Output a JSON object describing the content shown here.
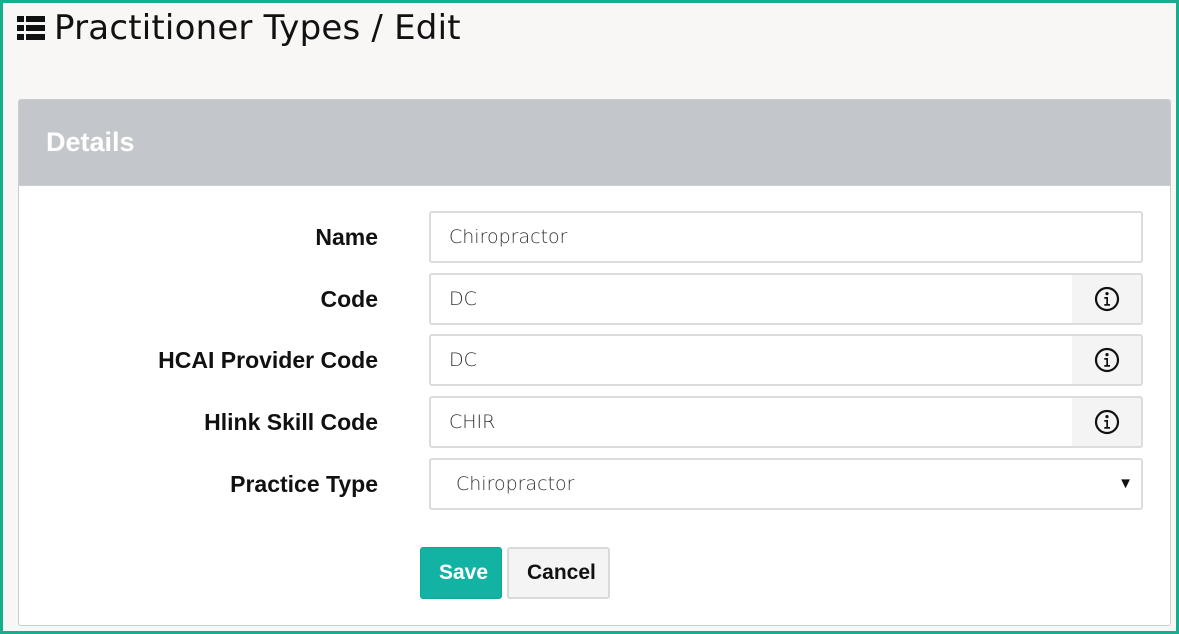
{
  "page": {
    "title": "Practitioner Types / Edit",
    "title_icon": "list-icon"
  },
  "panel": {
    "heading": "Details"
  },
  "form": {
    "name": {
      "label": "Name",
      "value": "Chiropractor"
    },
    "code": {
      "label": "Code",
      "value": "DC",
      "info_icon": "info-icon"
    },
    "hcai_provider_code": {
      "label": "HCAI Provider Code",
      "value": "DC",
      "info_icon": "info-icon"
    },
    "hlink_skill_code": {
      "label": "Hlink Skill Code",
      "value": "CHIR",
      "info_icon": "info-icon"
    },
    "practice_type": {
      "label": "Practice Type",
      "value": "Chiropractor"
    }
  },
  "actions": {
    "save_label": "Save",
    "cancel_label": "Cancel"
  },
  "colors": {
    "frame_border": "#18ad8f",
    "panel_heading_bg": "#c3c6ca",
    "save_button_bg": "#12b3a3"
  }
}
